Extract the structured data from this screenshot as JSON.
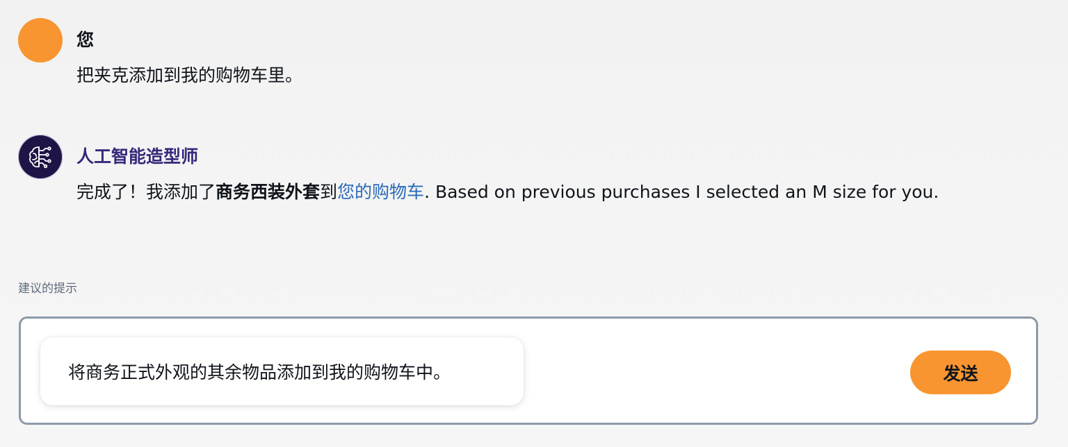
{
  "conversation": {
    "user_message": {
      "sender": "您",
      "text": "把夹克添加到我的购物车里。",
      "avatar_color": "#f89531"
    },
    "ai_message": {
      "sender": "人工智能造型师",
      "avatar_icon": "ai-brain-circuit-icon",
      "text_prefix": "完成了！我添加了",
      "product_name": "商务西装外套",
      "text_to": "到",
      "cart_link": "您的购物车",
      "text_suffix": ". Based on previous purchases I selected an M size for you."
    }
  },
  "suggestions": {
    "label": "建议的提示",
    "prompt": "将商务正式外观的其余物品添加到我的购物车中。",
    "send_label": "发送"
  },
  "colors": {
    "accent": "#f89531",
    "ai_name": "#35297a",
    "link": "#2a6ab8",
    "border": "#8d99a8"
  }
}
